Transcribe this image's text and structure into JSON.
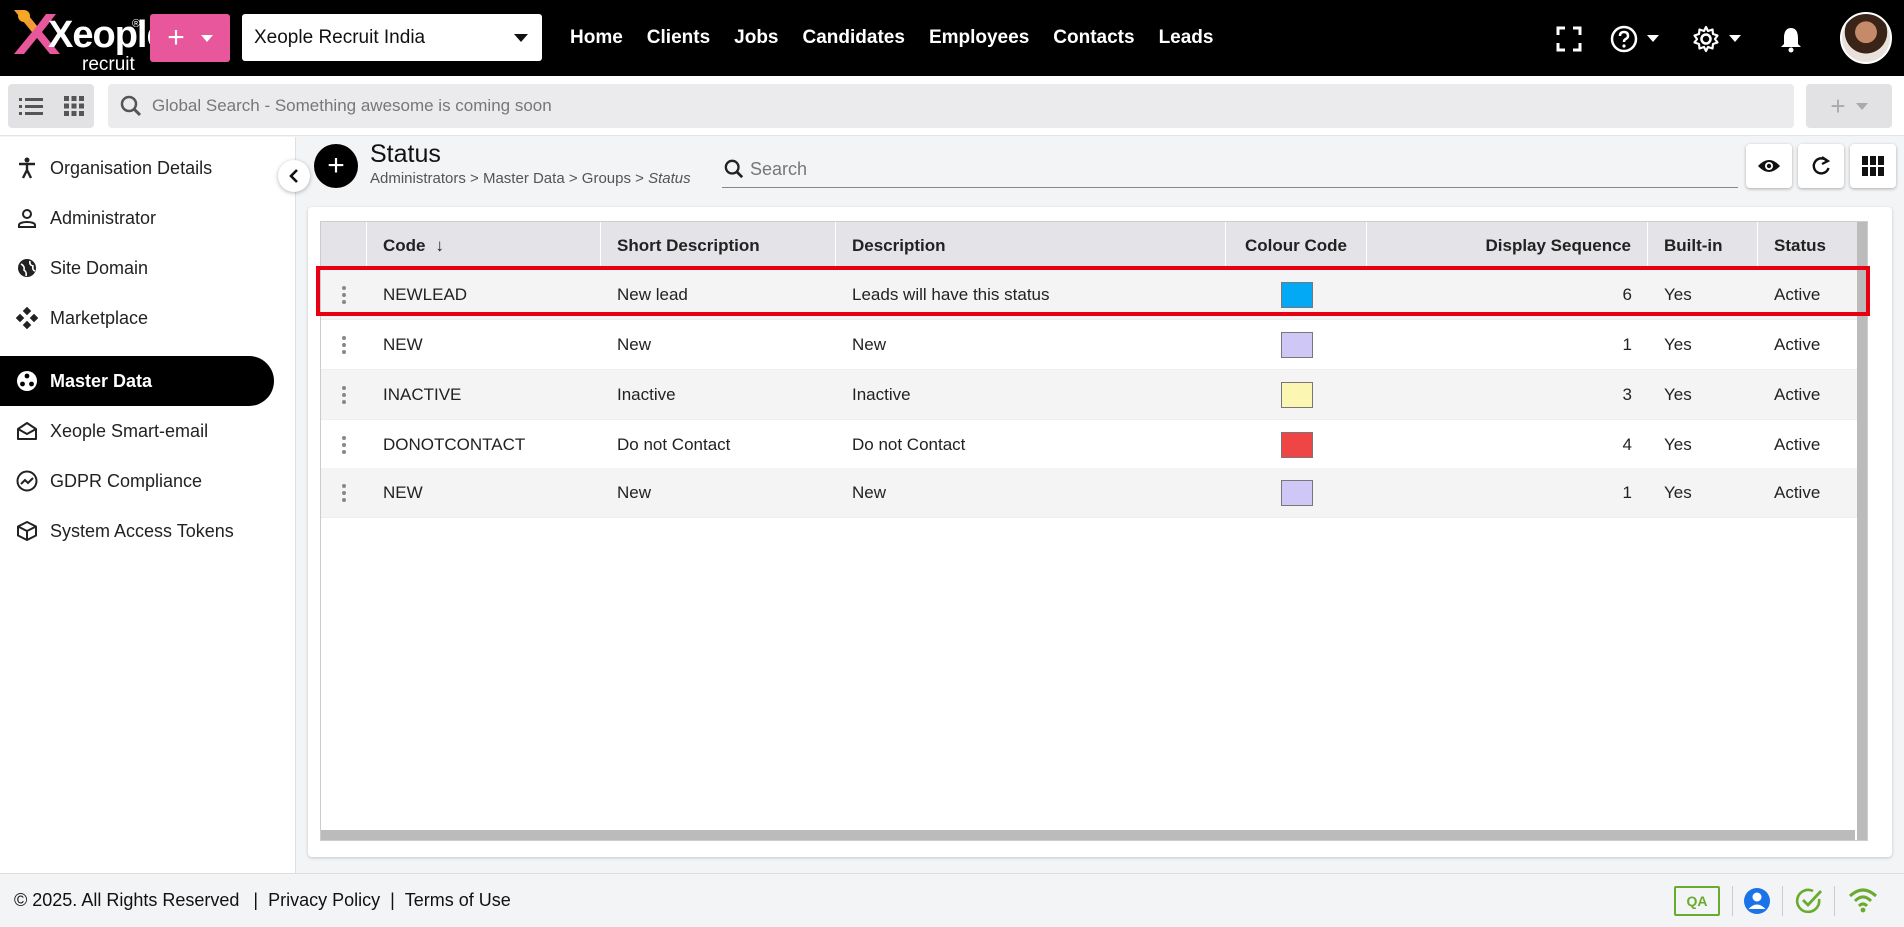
{
  "header": {
    "logo_text": "Xeople",
    "logo_sub": "recruit",
    "logo_reg": "®",
    "quick_add": "+",
    "tenant": "Xeople Recruit India",
    "nav": [
      "Home",
      "Clients",
      "Jobs",
      "Candidates",
      "Employees",
      "Contacts",
      "Leads"
    ]
  },
  "search": {
    "placeholder": "Global Search - Something awesome is coming soon",
    "add_label": "+"
  },
  "sidebar": {
    "items": [
      {
        "label": "Organisation Details",
        "icon": "accessibility-icon"
      },
      {
        "label": "Administrator",
        "icon": "person-icon"
      },
      {
        "label": "Site Domain",
        "icon": "globe-icon"
      },
      {
        "label": "Marketplace",
        "icon": "marketplace-icon"
      },
      {
        "label": "Master Data",
        "icon": "master-data-icon",
        "active": true
      },
      {
        "label": "Xeople Smart-email",
        "icon": "mail-icon"
      },
      {
        "label": "GDPR Compliance",
        "icon": "trending-icon"
      },
      {
        "label": "System Access Tokens",
        "icon": "cube-icon"
      }
    ]
  },
  "page": {
    "add_label": "+",
    "title": "Status",
    "breadcrumb": [
      "Administrators",
      "Master Data",
      "Groups",
      "Status"
    ],
    "breadcrumb_sep": ">",
    "search_placeholder": "Search"
  },
  "grid": {
    "columns": [
      "Code",
      "Short Description",
      "Description",
      "Colour Code",
      "Display Sequence",
      "Built-in",
      "Status"
    ],
    "sort_indicator": "↓",
    "rows": [
      {
        "code": "NEWLEAD",
        "short": "New lead",
        "desc": "Leads will have this status",
        "colour": "#03a9f4",
        "seq": "6",
        "builtin": "Yes",
        "status": "Active"
      },
      {
        "code": "NEW",
        "short": "New",
        "desc": "New",
        "colour": "#cfc8f7",
        "seq": "1",
        "builtin": "Yes",
        "status": "Active"
      },
      {
        "code": "INACTIVE",
        "short": "Inactive",
        "desc": "Inactive",
        "colour": "#fbf7b2",
        "seq": "3",
        "builtin": "Yes",
        "status": "Active"
      },
      {
        "code": "DONOTCONTACT",
        "short": "Do not Contact",
        "desc": "Do not Contact",
        "colour": "#f04545",
        "seq": "4",
        "builtin": "Yes",
        "status": "Active"
      },
      {
        "code": "NEW",
        "short": "New",
        "desc": "New",
        "colour": "#cfc8f7",
        "seq": "1",
        "builtin": "Yes",
        "status": "Active"
      }
    ]
  },
  "footer": {
    "copyright": "© 2025. All Rights Reserved",
    "separator": "|",
    "privacy": "Privacy Policy",
    "terms": "Terms of Use",
    "env_badge": "QA"
  },
  "colors": {
    "brand_pink": "#e8569b",
    "highlight": "#e60012",
    "footer_green": "#6aab2e"
  }
}
